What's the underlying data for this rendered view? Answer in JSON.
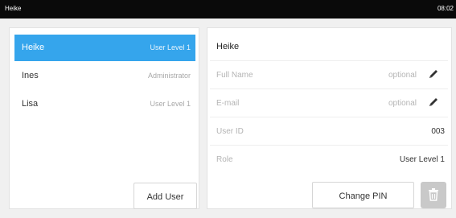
{
  "statusbar": {
    "title": "Heike",
    "time": "08:02"
  },
  "users": [
    {
      "name": "Heike",
      "role": "User Level 1"
    },
    {
      "name": "Ines",
      "role": "Administrator"
    },
    {
      "name": "Lisa",
      "role": "User Level 1"
    }
  ],
  "selected_user_index": 0,
  "add_user_label": "Add User",
  "details": {
    "name": "Heike",
    "full_name_label": "Full Name",
    "full_name_hint": "optional",
    "email_label": "E-mail",
    "email_hint": "optional",
    "user_id_label": "User ID",
    "user_id_value": "003",
    "role_label": "Role",
    "role_value": "User Level 1"
  },
  "change_pin_label": "Change PIN",
  "icons": {
    "edit": "pencil-icon",
    "delete": "trash-icon"
  },
  "colors": {
    "accent": "#35a5ec",
    "statusbar": "#0a0a0a",
    "disabled": "#c9c9c9"
  }
}
